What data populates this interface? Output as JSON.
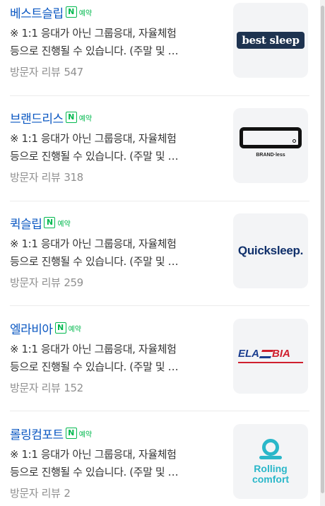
{
  "booking_label": "예약",
  "booking_icon_letter": "N",
  "review_label": "방문자 리뷰",
  "places": [
    {
      "name": "베스트슬립",
      "desc_line1": "※ 1:1 응대가 아닌 그룹응대, 자율체험",
      "desc_line2": "등으로 진행될 수 있습니다. (주말 및 …",
      "review_count": "547",
      "logo_text": "best sleep"
    },
    {
      "name": "브랜드리스",
      "desc_line1": "※ 1:1 응대가 아닌 그룹응대, 자율체험",
      "desc_line2": "등으로 진행될 수 있습니다. (주말 및 …",
      "review_count": "318",
      "logo_text": "BRAND·less"
    },
    {
      "name": "퀵슬립",
      "desc_line1": "※ 1:1 응대가 아닌 그룹응대, 자율체험",
      "desc_line2": "등으로 진행될 수 있습니다. (주말 및 …",
      "review_count": "259",
      "logo_text": "Quicksleep."
    },
    {
      "name": "엘라비아",
      "desc_line1": "※ 1:1 응대가 아닌 그룹응대, 자율체험",
      "desc_line2": "등으로 진행될 수 있습니다. (주말 및 …",
      "review_count": "152",
      "logo_text_a": "ELA",
      "logo_text_b": "BIA"
    },
    {
      "name": "롤링컴포트",
      "desc_line1": "※ 1:1 응대가 아닌 그룹응대, 자율체험",
      "desc_line2": "등으로 진행될 수 있습니다. (주말 및 …",
      "review_count": "2",
      "logo_text_line1": "Rolling",
      "logo_text_line2": "comfort"
    }
  ],
  "colors": {
    "title": "#0a57c2",
    "booking_green": "#03b94f",
    "body_text": "#333333",
    "meta_text": "#8f8f8f",
    "thumb_bg": "#f3f4f6"
  }
}
